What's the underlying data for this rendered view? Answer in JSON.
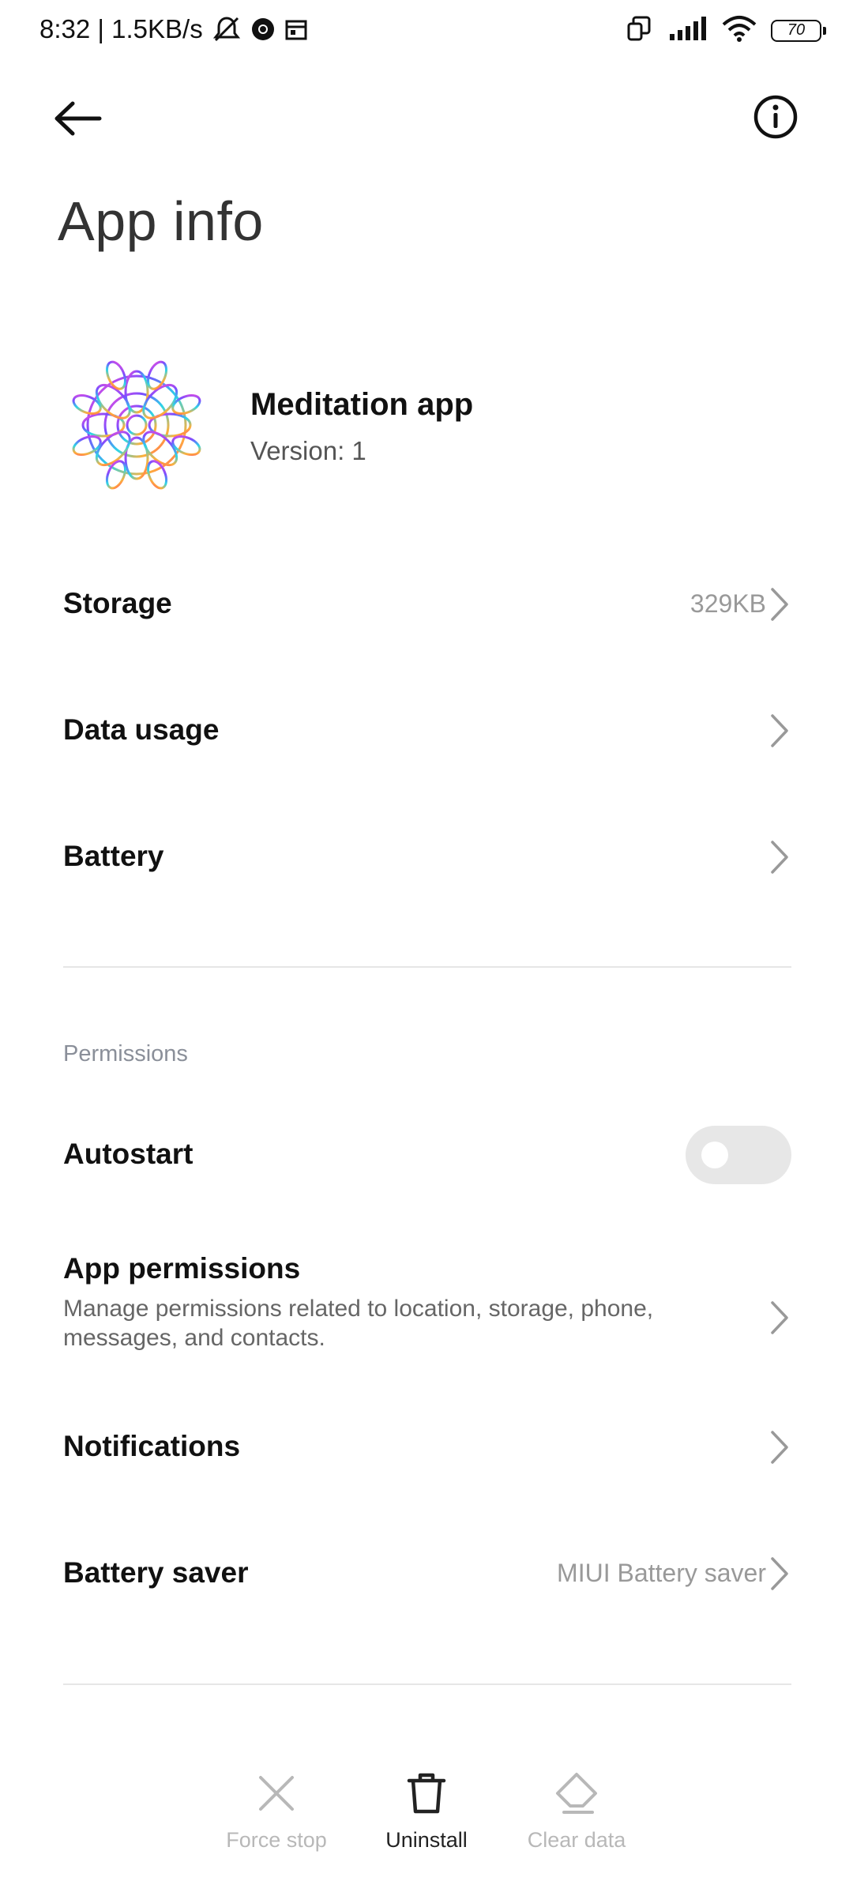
{
  "status_bar": {
    "time_speed": "8:32 | 1.5KB/s",
    "battery": "70",
    "icons": [
      "silent-mode-icon",
      "chrome-icon",
      "calendar-icon",
      "screen-mirror-icon",
      "signal-icon",
      "wifi-icon",
      "battery-icon"
    ]
  },
  "header": {
    "title": "App info",
    "back_icon": "arrow-left-icon",
    "info_icon": "info-icon"
  },
  "app": {
    "name": "Meditation app",
    "version": "Version: 1"
  },
  "rows": {
    "storage": {
      "label": "Storage",
      "value": "329KB"
    },
    "data_usage": {
      "label": "Data usage"
    },
    "battery": {
      "label": "Battery"
    },
    "autostart": {
      "label": "Autostart",
      "enabled": false
    },
    "app_permissions": {
      "label": "App permissions",
      "description": "Manage permissions related to location, storage, phone, messages, and contacts."
    },
    "notifications": {
      "label": "Notifications"
    },
    "battery_saver": {
      "label": "Battery saver",
      "value": "MIUI Battery saver"
    }
  },
  "sections": {
    "permissions": "Permissions"
  },
  "actions": {
    "force_stop": {
      "label": "Force stop",
      "enabled": false
    },
    "uninstall": {
      "label": "Uninstall",
      "enabled": true
    },
    "clear_data": {
      "label": "Clear data",
      "enabled": false
    }
  },
  "colors": {
    "primary_text": "#111111",
    "secondary_text": "#999999",
    "section_label": "#8a8f99",
    "disabled": "#b8b8b8",
    "toggle_off": "#e7e7e7"
  }
}
